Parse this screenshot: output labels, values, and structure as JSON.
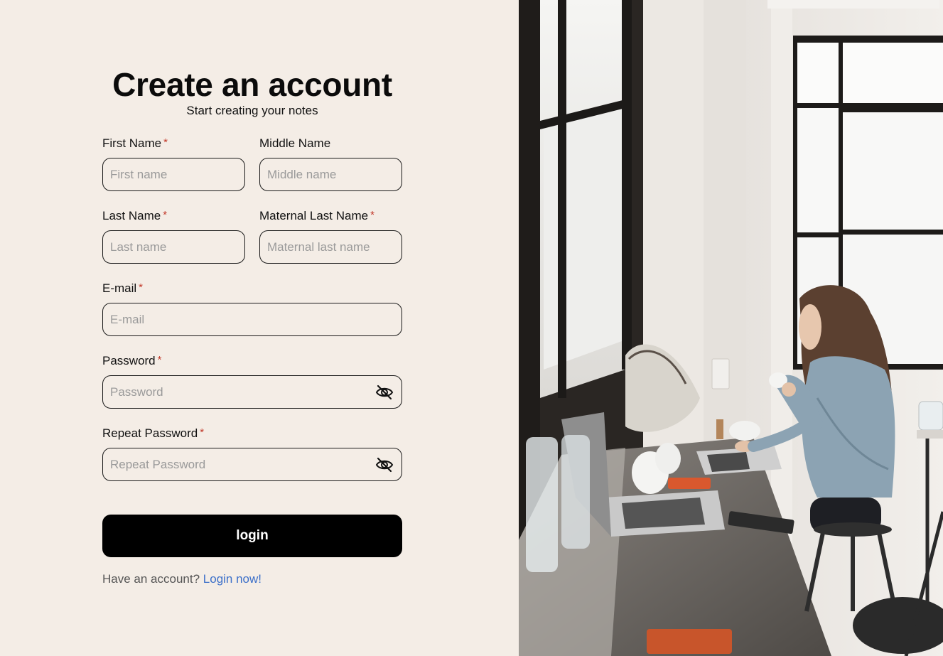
{
  "header": {
    "title": "Create an account",
    "subtitle": "Start creating your notes"
  },
  "form": {
    "required_marker": "*",
    "first_name": {
      "label": "First Name",
      "placeholder": "First name",
      "required": true
    },
    "middle_name": {
      "label": "Middle Name",
      "placeholder": "Middle name",
      "required": false
    },
    "last_name": {
      "label": "Last Name",
      "placeholder": "Last name",
      "required": true
    },
    "maternal_last_name": {
      "label": "Maternal Last Name",
      "placeholder": "Maternal last name",
      "required": true
    },
    "email": {
      "label": "E-mail",
      "placeholder": "E-mail",
      "required": true
    },
    "password": {
      "label": "Password",
      "placeholder": "Password",
      "required": true,
      "icon": "eye-slash-icon"
    },
    "repeat_password": {
      "label": "Repeat Password",
      "placeholder": "Repeat Password",
      "required": true,
      "icon": "eye-slash-icon"
    },
    "submit_label": "login"
  },
  "footer": {
    "prompt": "Have an account?",
    "link_label": "Login now!"
  },
  "colors": {
    "background": "#f4ede6",
    "button": "#000000",
    "link": "#3b6fc9",
    "required": "#c23a2b"
  },
  "image": {
    "description_icon": "photo-woman-laptop-cafe"
  }
}
